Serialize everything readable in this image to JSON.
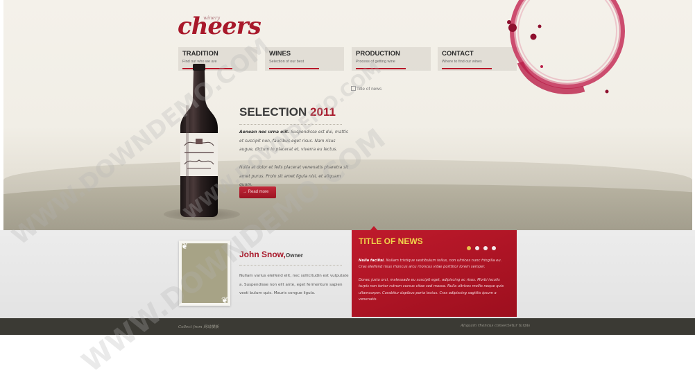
{
  "brand": {
    "logo_text": "cheers",
    "logo_tag": "winery",
    "accent": "#a8182a"
  },
  "nav": [
    {
      "label": "TRADITION",
      "sub": "Find out who we are"
    },
    {
      "label": "WINES",
      "sub": "Selection of our best"
    },
    {
      "label": "PRODUCTION",
      "sub": "Process of getting wine"
    },
    {
      "label": "CONTACT",
      "sub": "Where to find our wines"
    }
  ],
  "selection": {
    "heading": "SELECTION",
    "year": "2011",
    "lead": "Aenean nec urna elit.",
    "p1_rest": " Suspendisse est dui, mattis et suscipit non, faucibus eget risus. Nam risus augue, dictum in placerat et, viverra eu lectus.",
    "p2": "Nulla at dolor et felis placerat venenatis pharetra sit amet purus. Proin sit amet ligula nisi, et aliquam quam.",
    "read_more": "→ Read more"
  },
  "news_image_alt": "Title of news",
  "person": {
    "name": "John Snow,",
    "role": "Owner",
    "bio": "Nullam varius eleifend elit, nec sollicitudin est vulputate a. Suspendisse non elit ante, eget fermentum sapien vesti bulum quis. Mauris congue ligula."
  },
  "news": {
    "title": "TITLE OF NEWS",
    "lead": "Nulla facilisi.",
    "p1_rest": " Nullam tristique vestibulum tellus, non ultrices nunc fringilla eu. Cras eleifend risus rhoncus arcu rhoncus vitae porttitor lorem semper.",
    "p2": "Donec justo orci, malesuada eu suscipit eget, adipiscing ac risus. Morbi iaculis turpis non tortor rutrum cursus vitae sed massa. Nulla ultrices mollis neque quis ullamcorper. Curabitur dapibus porta lectus. Cras adipiscing sagittis ipsum a venenatis.",
    "dots_count": 4,
    "active_dot": 0
  },
  "footer": {
    "left": "Collect from 网站模板",
    "right": "Aliquam rhoncus consectetur turpis"
  },
  "watermark": "WWW.DOWNDEMO.COM"
}
